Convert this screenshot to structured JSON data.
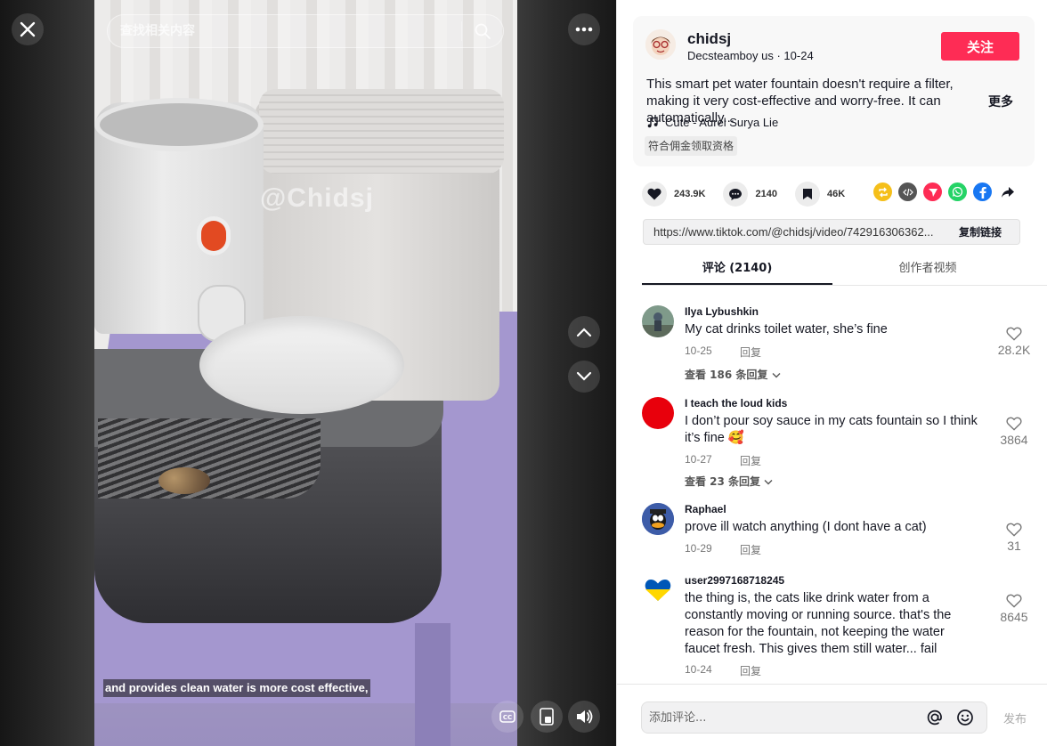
{
  "video": {
    "search_placeholder": "查找相关内容",
    "watermark": "@Chidsj",
    "caption": "and provides clean water is more cost effective,"
  },
  "post": {
    "username": "chidsj",
    "display_name": "Decsteamboy us",
    "date": "10-24",
    "meta_separator": "·",
    "follow_label": "关注",
    "description": "This smart pet water fountain doesn't require a filter, making it very cost-effective and worry-free. It can automatically...",
    "more_label": "更多",
    "music": "Cute - Aurel Surya Lie",
    "eligible_tag": "符合佣金领取资格"
  },
  "stats": {
    "likes": "243.9K",
    "comments": "2140",
    "saves": "46K"
  },
  "share_icons": [
    {
      "name": "repost-icon",
      "color": "#f5bf1a"
    },
    {
      "name": "embed-icon",
      "color": "#555555"
    },
    {
      "name": "send-icon",
      "color": "#fe2c55"
    },
    {
      "name": "whatsapp-icon",
      "color": "#25d366"
    },
    {
      "name": "facebook-icon",
      "color": "#1877f2"
    }
  ],
  "link": {
    "url": "https://www.tiktok.com/@chidsj/video/742916306362...",
    "copy_label": "复制链接"
  },
  "tabs": {
    "comments": "评论 (2140)",
    "creator_videos": "创作者视频"
  },
  "reply_label": "回复",
  "comments": [
    {
      "user": "Ilya Lybushkin",
      "text": "My cat drinks toilet water, she’s fine",
      "date": "10-25",
      "likes": "28.2K",
      "view_replies": "查看 186 条回复"
    },
    {
      "user": "I teach the loud kids",
      "text": "I don’t pour soy sauce in my cats fountain so I think it’s fine 🥰",
      "date": "10-27",
      "likes": "3864",
      "view_replies": "查看 23 条回复"
    },
    {
      "user": "Raphael",
      "text": "prove ill watch anything (I dont have a cat)",
      "date": "10-29",
      "likes": "31"
    },
    {
      "user": "user2997168718245",
      "text": "the thing is, the cats like drink water from a constantly moving or running source. that's the reason for the fountain, not keeping the water faucet fresh. This gives them still water... fail",
      "date": "10-24",
      "likes": "8645"
    }
  ],
  "compose": {
    "placeholder": "添加评论...",
    "publish_label": "发布"
  },
  "colors": {
    "accent": "#fe2c55",
    "text": "#161823"
  }
}
